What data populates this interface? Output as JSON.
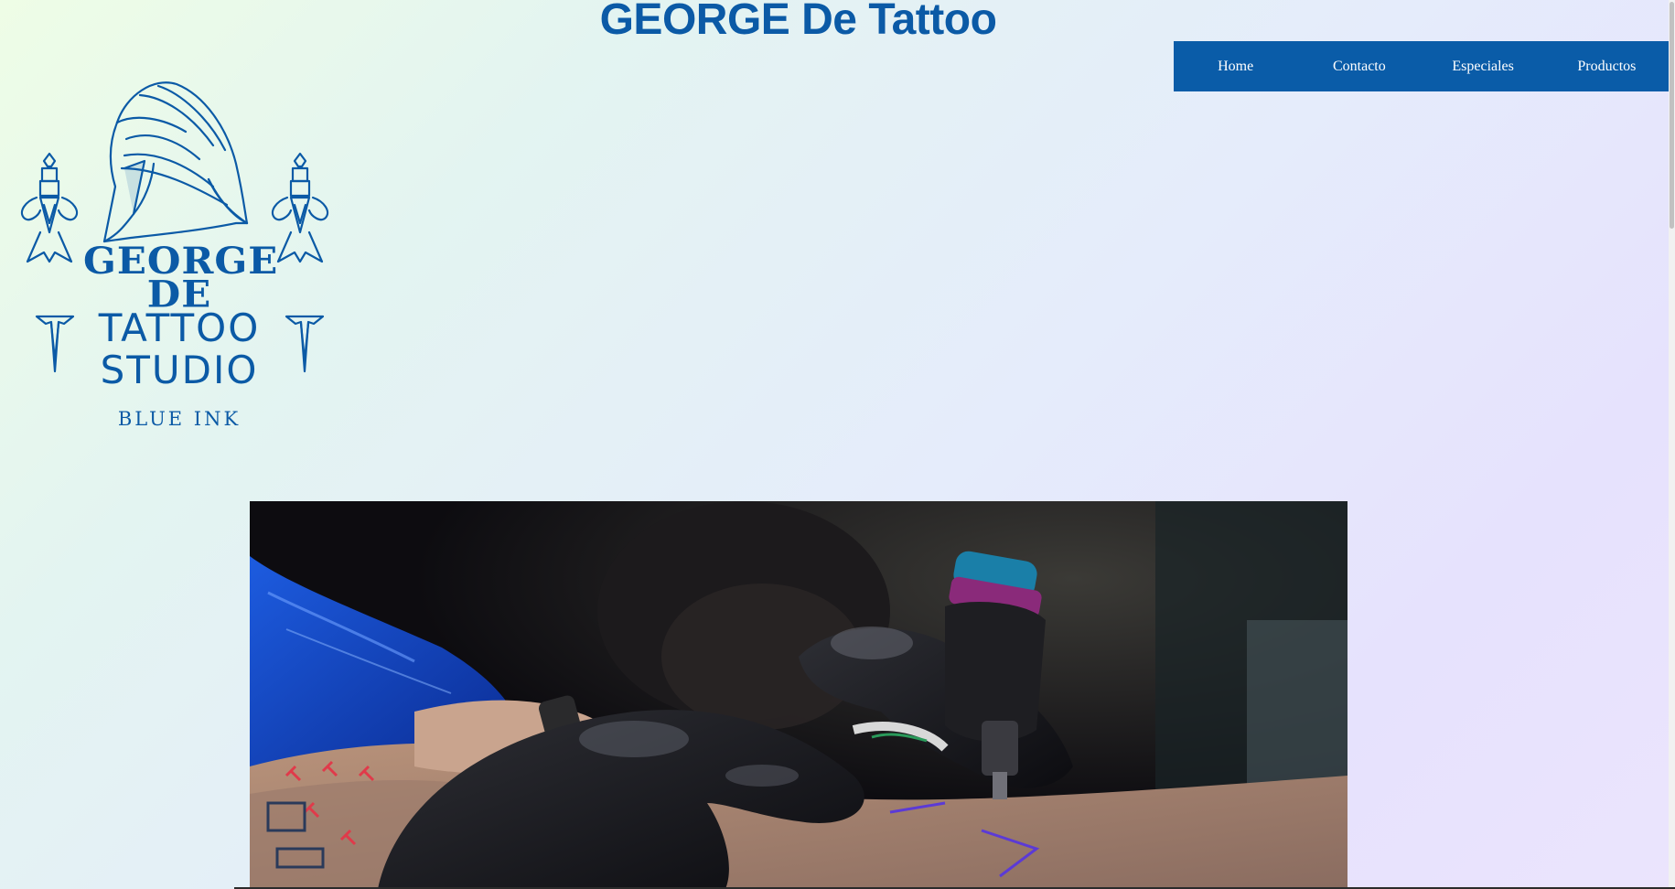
{
  "site": {
    "title": "GEORGE De Tattoo"
  },
  "nav": {
    "items": [
      {
        "label": "Home"
      },
      {
        "label": "Contacto"
      },
      {
        "label": "Especiales"
      },
      {
        "label": "Productos"
      }
    ]
  },
  "logo": {
    "name": "GEORGE DE",
    "studio": "TATTOO STUDIO",
    "tagline": "BLUE INK",
    "icon": "spartan-helmet-dagger-logo"
  },
  "hero": {
    "image": "tattoo-artist-gloved-hands-photo"
  },
  "colors": {
    "brand": "#0b5aa6",
    "nav_bg": "#0a5ca8",
    "nav_text": "#ffffff"
  }
}
